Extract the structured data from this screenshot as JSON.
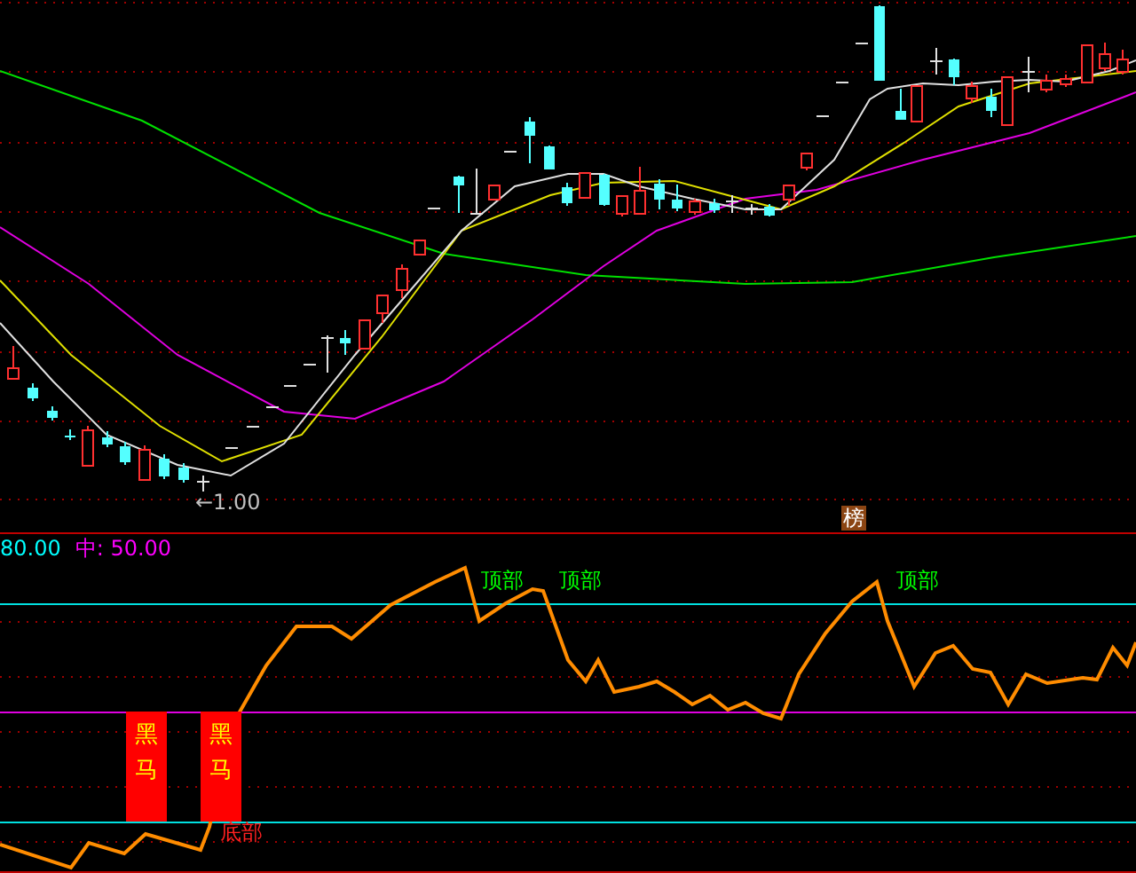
{
  "main_chart": {
    "low_marker": "←1.00",
    "badge": "榜"
  },
  "indicator": {
    "legend": [
      {
        "text": "80.00",
        "color": "#00ffff"
      },
      {
        "text": "中: 50.00",
        "color": "#ff00ff"
      }
    ],
    "signals": [
      {
        "kind": "top",
        "text": "顶部"
      },
      {
        "kind": "top",
        "text": "顶部"
      },
      {
        "kind": "top",
        "text": "顶部"
      },
      {
        "kind": "buy",
        "text": "黑马"
      },
      {
        "kind": "buy",
        "text": "黑马"
      },
      {
        "kind": "bottom",
        "text": "底部"
      }
    ]
  }
}
